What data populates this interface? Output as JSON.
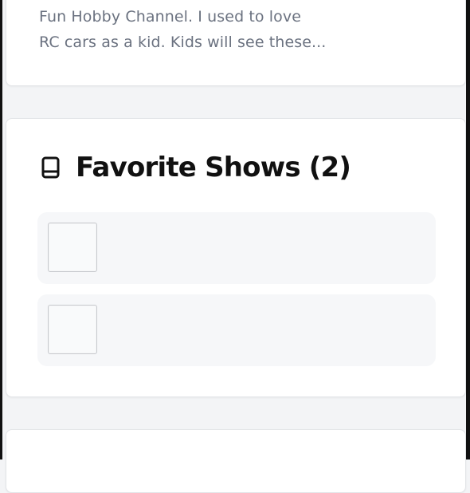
{
  "snippet": {
    "line1": "Fun Hobby Channel. I used to love",
    "line2": "RC cars as a kid. Kids will see these..."
  },
  "favorites": {
    "title": "Favorite Shows (2)",
    "icon": "book-icon",
    "items": [
      {
        "thumbnail": "placeholder"
      },
      {
        "thumbnail": "placeholder"
      }
    ]
  }
}
